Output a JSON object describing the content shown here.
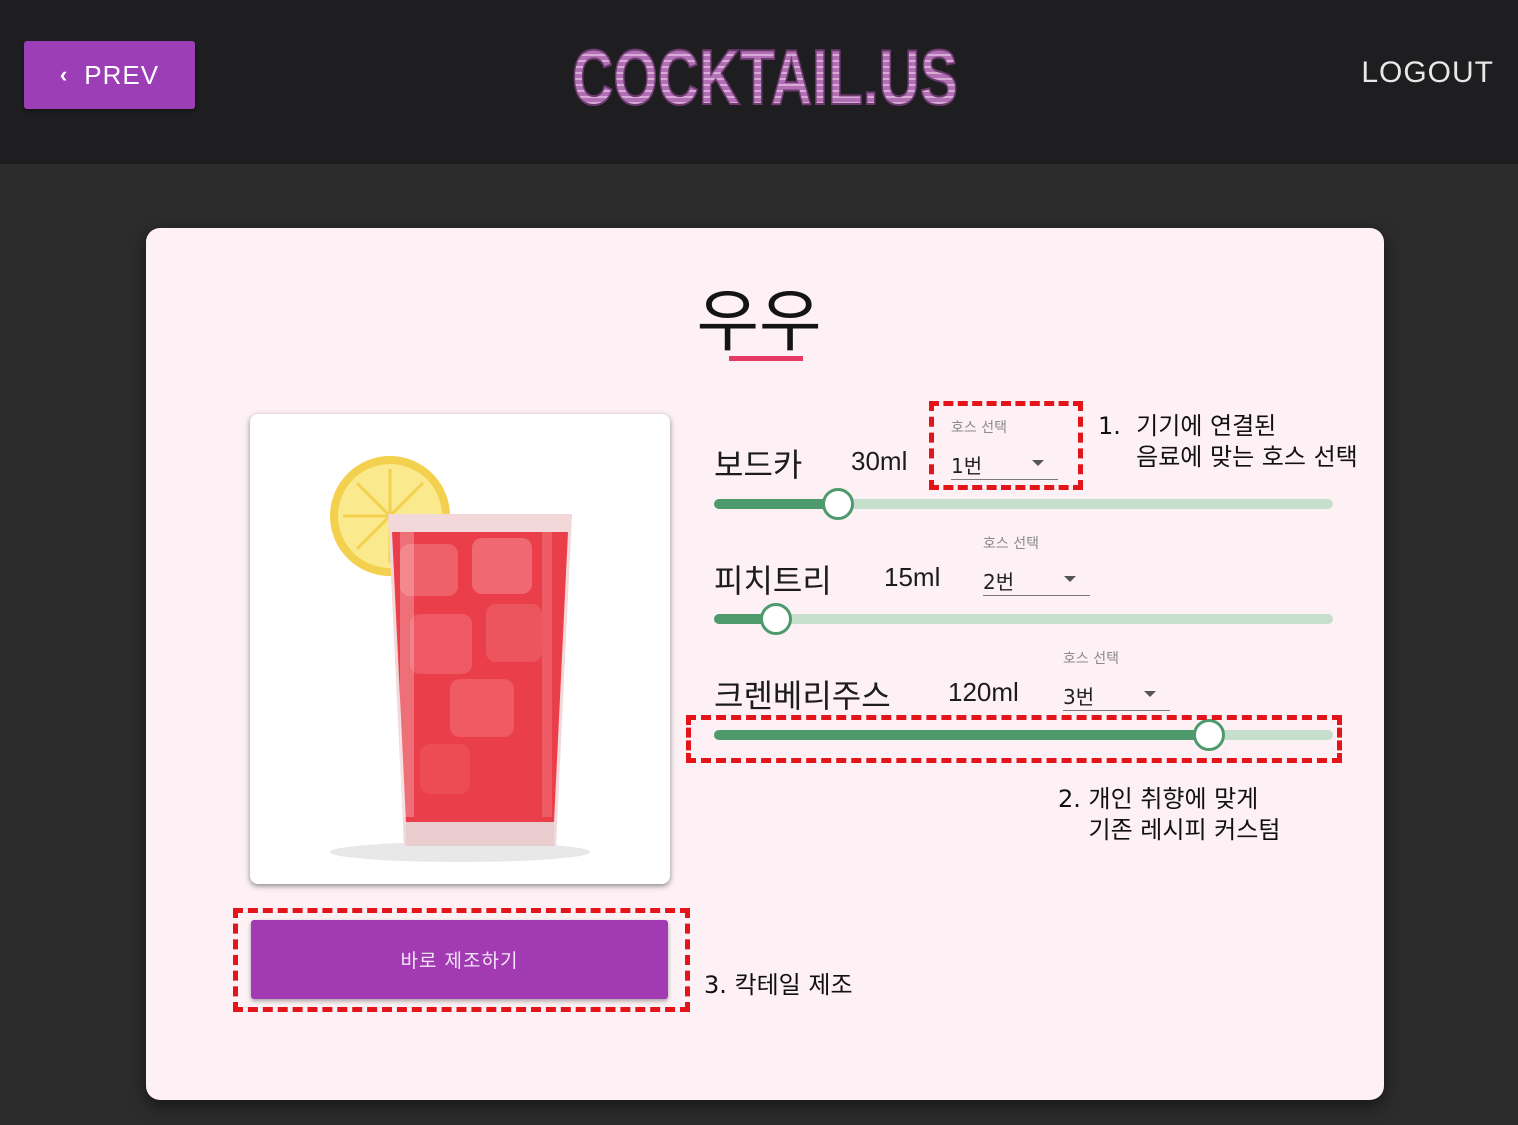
{
  "header": {
    "prev_label": "PREV",
    "logo_text": "COCKTAIL.US",
    "logout_label": "LOGOUT",
    "colors": {
      "bar": "#1e1e20",
      "prev_button": "#9c3eb5",
      "logo": "#b57ab5"
    }
  },
  "recipe": {
    "title": "우우",
    "make_button_label": "바로 제조하기",
    "hose_label": "호스 선택",
    "image_icon": "red-cocktail-glass-with-lemon",
    "ingredients": [
      {
        "name": "보드카",
        "amount": "30ml",
        "hose": "1번",
        "level": 0.2
      },
      {
        "name": "피치트리",
        "amount": "15ml",
        "hose": "2번",
        "level": 0.1
      },
      {
        "name": "크렌베리주스",
        "amount": "120ml",
        "hose": "3번",
        "level": 0.8
      }
    ],
    "colors": {
      "slider_fill": "#4e9a6c",
      "slider_track": "#c6dfcd",
      "title_underline": "#e53a64",
      "make_button": "#a23ab4"
    }
  },
  "annotations": {
    "select_hose": "1.  기기에 연결된\n     음료에 맞는 호스 선택",
    "customize": "2. 개인 취향에 맞게\n    기존 레시피 커스텀",
    "make": "3. 칵테일 제조",
    "color": "#e4141b"
  }
}
